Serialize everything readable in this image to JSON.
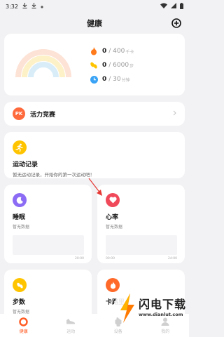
{
  "status_bar": {
    "time": "3:32"
  },
  "header": {
    "title": "健康"
  },
  "summary": {
    "metrics": [
      {
        "value": "0",
        "goal": "/ 400",
        "unit": "千卡",
        "icon": "flame-icon",
        "color": "#ff7a1a"
      },
      {
        "value": "0",
        "goal": "/ 6000",
        "unit": "步",
        "icon": "footprint-icon",
        "color": "#ffc400"
      },
      {
        "value": "0",
        "goal": "/ 30",
        "unit": "分钟",
        "icon": "clock-icon",
        "color": "#3aa3f5"
      }
    ],
    "rainbow_colors": [
      "#fde2d6",
      "#fdf1c8",
      "#d9edf8"
    ]
  },
  "vitality": {
    "badge": "PK",
    "label": "活力竞赛"
  },
  "record": {
    "label": "运动记录",
    "desc": "暂无运动记录，开始你的第一次运动吧！"
  },
  "sleep": {
    "label": "睡眠",
    "sub": "暂无数据",
    "axis_end": "20:00"
  },
  "heart": {
    "label": "心率",
    "sub": "暂无数据",
    "axis_start": "00:00",
    "axis_end": "24:00"
  },
  "steps": {
    "label": "步数",
    "sub": "暂无数据"
  },
  "calories": {
    "label": "卡路里"
  },
  "tabbar": {
    "items": [
      {
        "label": "健康",
        "icon": "heart-ring-icon",
        "active": true
      },
      {
        "label": "运动",
        "icon": "shoe-icon",
        "active": false
      },
      {
        "label": "设备",
        "icon": "watch-icon",
        "active": false
      },
      {
        "label": "我的",
        "icon": "person-icon",
        "active": false
      }
    ],
    "accent": "#ff5a22"
  },
  "watermark": {
    "text": "闪电下载",
    "url": "www.dianlut.com"
  }
}
